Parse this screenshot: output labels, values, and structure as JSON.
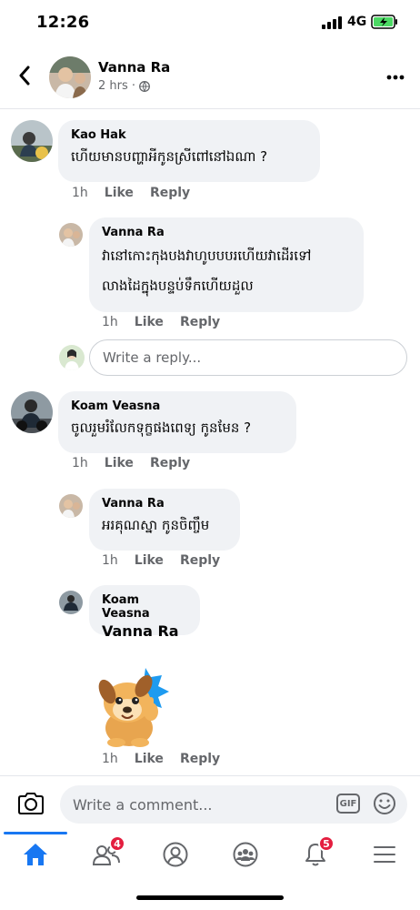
{
  "status_bar": {
    "time": "12:26",
    "network": "4G"
  },
  "post": {
    "author": "Vanna Ra",
    "time": "2 hrs ·"
  },
  "comments": [
    {
      "author": "Kao Hak",
      "text": "ហើយមានបញ្ហាអីកូនស្រីពៅនៅឯណា ?",
      "actions": {
        "time": "1h",
        "like": "Like",
        "reply": "Reply"
      },
      "reply": {
        "author": "Vanna Ra",
        "lines": [
          "វានៅកោះកុងបងវាហូបបបរហើយវាដើរទៅ",
          "លាងដៃក្នុងបន្ទប់ទឹកហើយដួល"
        ],
        "actions": {
          "time": "1h",
          "like": "Like",
          "reply": "Reply"
        }
      },
      "reply_placeholder": "Write a reply..."
    },
    {
      "author": "Koam Veasna",
      "text": "ចូលរួមរំលែកទុក្ខផងពេទ្យ កូនមែន ?",
      "actions": {
        "time": "1h",
        "like": "Like",
        "reply": "Reply"
      },
      "replies": [
        {
          "author": "Vanna Ra",
          "text": "អរគុណស្នា កូនចិញ្ចឹម",
          "actions": {
            "time": "1h",
            "like": "Like",
            "reply": "Reply"
          }
        },
        {
          "author": "Koam Veasna",
          "mention": "Vanna Ra",
          "actions": {
            "time": "1h",
            "like": "Like",
            "reply": "Reply"
          }
        }
      ]
    }
  ],
  "composer": {
    "placeholder": "Write a comment...",
    "gif_label": "GIF"
  },
  "nav": {
    "friends_badge": "4",
    "notifications_badge": "5"
  },
  "colors": {
    "accent": "#1877f2",
    "badge": "#e41e3f",
    "bubble": "#f0f2f5",
    "muted": "#65676b"
  }
}
